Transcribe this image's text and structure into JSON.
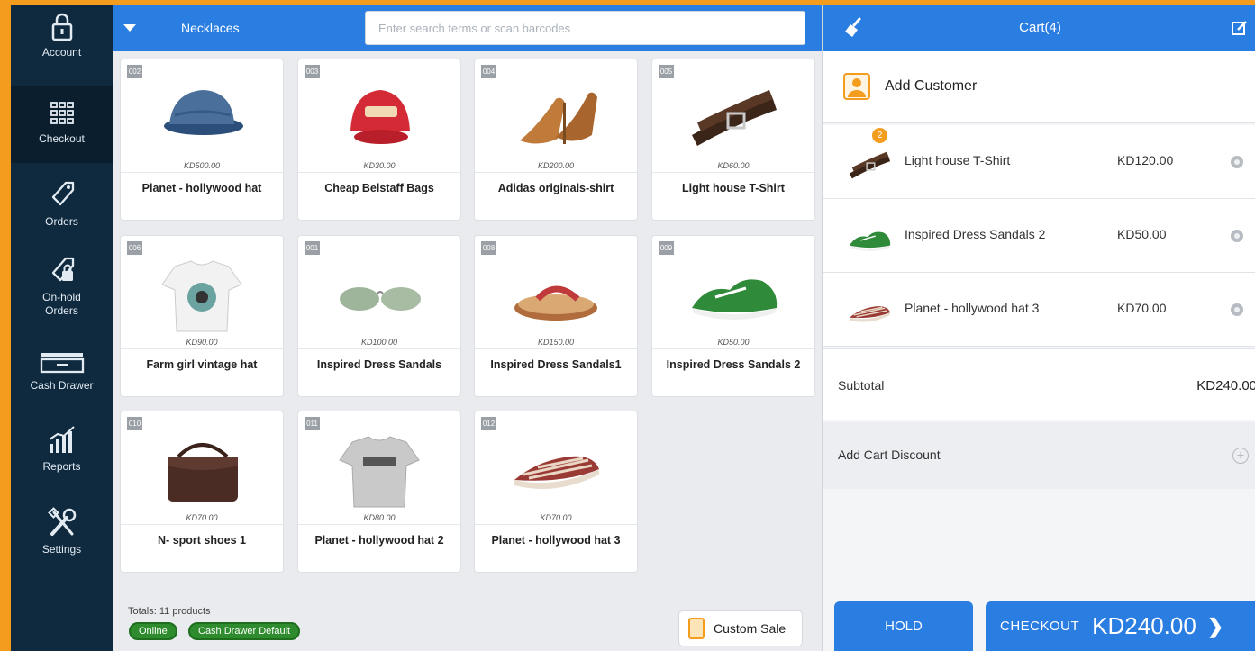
{
  "sidebar": {
    "items": [
      {
        "label": "Account",
        "icon": "lock-icon"
      },
      {
        "label": "Checkout",
        "icon": "grid-icon"
      },
      {
        "label": "Orders",
        "icon": "tag-icon"
      },
      {
        "label": "On-hold Orders",
        "icon": "tag-lock-icon"
      },
      {
        "label": "Cash Drawer",
        "icon": "cash-drawer-icon"
      },
      {
        "label": "Reports",
        "icon": "bar-chart-icon"
      },
      {
        "label": "Settings",
        "icon": "tools-icon"
      }
    ]
  },
  "products": {
    "category": "Necklaces",
    "search_placeholder": "Enter search terms or scan barcodes",
    "items": [
      {
        "sku": "002",
        "price": "KD500.00",
        "name": "Planet - hollywood hat",
        "img": "cap-blue"
      },
      {
        "sku": "003",
        "price": "KD30.00",
        "name": "Cheap Belstaff Bags",
        "img": "cap-red"
      },
      {
        "sku": "004",
        "price": "KD200.00",
        "name": "Adidas originals-shirt",
        "img": "heels"
      },
      {
        "sku": "005",
        "price": "KD60.00",
        "name": "Light house T-Shirt",
        "img": "belt"
      },
      {
        "sku": "006",
        "price": "KD90.00",
        "name": "Farm girl vintage hat",
        "img": "tshirt-white"
      },
      {
        "sku": "001",
        "price": "KD100.00",
        "name": "Inspired Dress Sandals",
        "img": "sunglasses"
      },
      {
        "sku": "008",
        "price": "KD150.00",
        "name": "Inspired Dress Sandals1",
        "img": "sandal"
      },
      {
        "sku": "009",
        "price": "KD50.00",
        "name": "Inspired Dress Sandals 2",
        "img": "sneaker-green"
      },
      {
        "sku": "010",
        "price": "KD70.00",
        "name": "N- sport shoes 1",
        "img": "bag"
      },
      {
        "sku": "011",
        "price": "KD80.00",
        "name": "Planet - hollywood hat 2",
        "img": "tshirt-grey"
      },
      {
        "sku": "012",
        "price": "KD70.00",
        "name": "Planet - hollywood hat 3",
        "img": "shoe-striped"
      }
    ],
    "totals": "Totals: 11 products",
    "status_pills": [
      "Online",
      "Cash Drawer Default"
    ],
    "custom_sale": "Custom Sale"
  },
  "cart": {
    "title": "Cart(4)",
    "add_customer": "Add Customer",
    "items": [
      {
        "name": "Light house T-Shirt",
        "price": "KD120.00",
        "qty": "2",
        "img": "belt"
      },
      {
        "name": "Inspired Dress Sandals 2",
        "price": "KD50.00",
        "img": "sneaker-green"
      },
      {
        "name": "Planet - hollywood hat 3",
        "price": "KD70.00",
        "img": "shoe-striped"
      }
    ],
    "subtotal_label": "Subtotal",
    "subtotal_value": "KD240.00",
    "discount_label": "Add Cart Discount",
    "hold_label": "HOLD",
    "checkout_label": "CHECKOUT",
    "checkout_total": "KD240.00"
  },
  "colors": {
    "accent": "#2a7de1",
    "sidebar": "#0f2a3f",
    "frame": "#f39c1e",
    "pill": "#2e8b2e"
  }
}
